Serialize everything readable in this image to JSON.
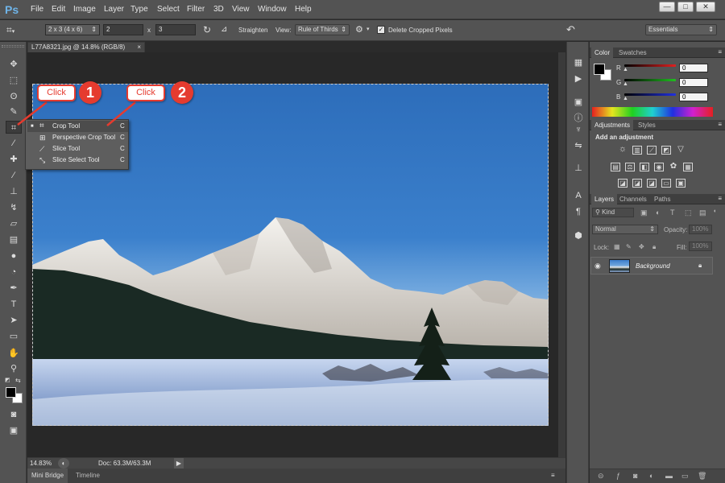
{
  "app": {
    "logo": "Ps"
  },
  "menu": [
    "File",
    "Edit",
    "Image",
    "Layer",
    "Type",
    "Select",
    "Filter",
    "3D",
    "View",
    "Window",
    "Help"
  ],
  "window_controls": [
    "—",
    "□",
    "✕"
  ],
  "options_bar": {
    "ratio_preset": "2 x 3 (4 x 6)",
    "width_value": "2",
    "times_sign": "x",
    "height_value": "3",
    "straighten_label": "Straighten",
    "view_label": "View:",
    "view_value": "Rule of Thirds",
    "delete_cropped_label": "Delete Cropped Pixels",
    "delete_cropped_checked": true,
    "workspace": "Essentials"
  },
  "document": {
    "tab_title": "L77A8321.jpg @ 14.8% (RGB/8)",
    "zoom": "14.83%",
    "doc_size": "Doc: 63.3M/63.3M"
  },
  "bottom_tabs": [
    "Mini Bridge",
    "Timeline"
  ],
  "flyout": {
    "items": [
      {
        "label": "Crop Tool",
        "shortcut": "C",
        "selected": true,
        "icon": "crop-icon"
      },
      {
        "label": "Perspective Crop Tool",
        "shortcut": "C",
        "selected": false,
        "icon": "perspective-crop-icon"
      },
      {
        "label": "Slice Tool",
        "shortcut": "C",
        "selected": false,
        "icon": "slice-icon"
      },
      {
        "label": "Slice Select Tool",
        "shortcut": "C",
        "selected": false,
        "icon": "slice-select-icon"
      }
    ]
  },
  "annotations": [
    {
      "label": "Click",
      "number": "1"
    },
    {
      "label": "Click",
      "number": "2"
    }
  ],
  "color_panel": {
    "tabs": [
      "Color",
      "Swatches"
    ],
    "channels": [
      {
        "name": "R",
        "value": "0",
        "color": "#e02020"
      },
      {
        "name": "G",
        "value": "0",
        "color": "#20c020"
      },
      {
        "name": "B",
        "value": "0",
        "color": "#2030e0"
      }
    ]
  },
  "adjustments_panel": {
    "tabs": [
      "Adjustments",
      "Styles"
    ],
    "heading": "Add an adjustment"
  },
  "layers_panel": {
    "tabs": [
      "Layers",
      "Channels",
      "Paths"
    ],
    "filter_kind": "Kind",
    "blend_mode": "Normal",
    "opacity_label": "Opacity:",
    "opacity_value": "100%",
    "lock_label": "Lock:",
    "fill_label": "Fill:",
    "fill_value": "100%",
    "layer_name": "Background"
  },
  "colors": {
    "accent_red": "#e53b2f",
    "ps_blue": "#6fb4e8"
  }
}
